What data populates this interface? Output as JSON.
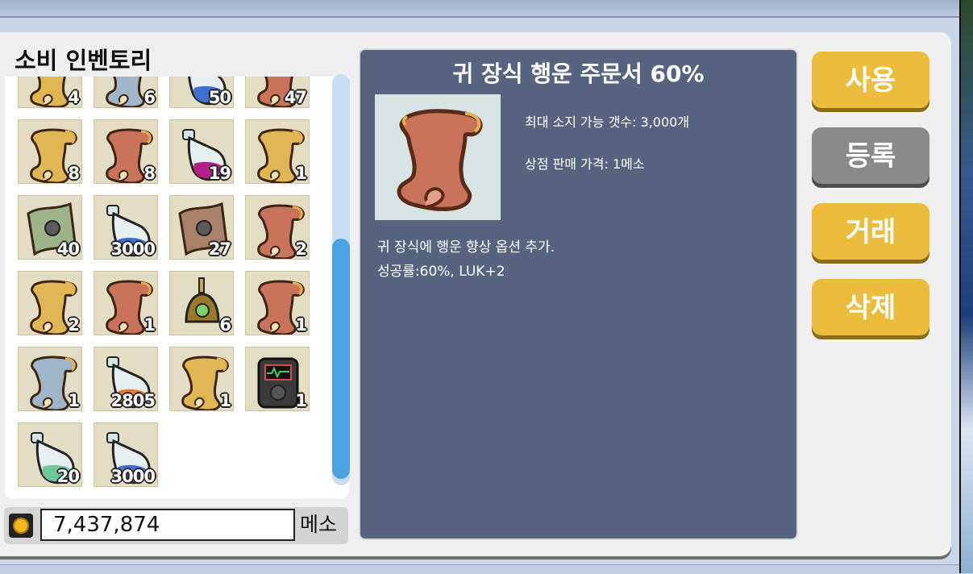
{
  "inventory": {
    "title": "소비 인벤토리",
    "slots": [
      {
        "type": "scroll-gold",
        "qty": "4"
      },
      {
        "type": "scroll-blue",
        "qty": "6"
      },
      {
        "type": "potion-blue",
        "qty": "50"
      },
      {
        "type": "scroll-red",
        "qty": "47"
      },
      {
        "type": "scroll-gold",
        "qty": "8"
      },
      {
        "type": "scroll-red",
        "qty": "8"
      },
      {
        "type": "potion-magenta",
        "qty": "19"
      },
      {
        "type": "scroll-gold",
        "qty": "1"
      },
      {
        "type": "scroll-green-map",
        "qty": "40"
      },
      {
        "type": "potion-blue",
        "qty": "3000"
      },
      {
        "type": "scroll-brown-map",
        "qty": "27"
      },
      {
        "type": "scroll-red",
        "qty": "2"
      },
      {
        "type": "scroll-gold",
        "qty": "2"
      },
      {
        "type": "scroll-red",
        "qty": "1"
      },
      {
        "type": "bell",
        "qty": "6"
      },
      {
        "type": "scroll-red",
        "qty": "1"
      },
      {
        "type": "scroll-blue",
        "qty": "1"
      },
      {
        "type": "potion-orange",
        "qty": "2805"
      },
      {
        "type": "scroll-gold",
        "qty": "1"
      },
      {
        "type": "device",
        "qty": "1"
      },
      {
        "type": "potion-green",
        "qty": "20"
      },
      {
        "type": "potion-blue",
        "qty": "3000"
      }
    ]
  },
  "meso": {
    "amount": "7,437,874",
    "unit": "메소"
  },
  "detail": {
    "title": "귀 장식 행운 주문서 60%",
    "max_stack": "최대 소지 가능 갯수: 3,000개",
    "shop_price": "상점 판매 가격: 1메소",
    "desc_line1": "귀 장식에 행운 향상 옵션 추가.",
    "desc_line2": "성공률:60%, LUK+2"
  },
  "buttons": {
    "use": "사용",
    "register": "등록",
    "trade": "거래",
    "delete": "삭제"
  },
  "colors": {
    "scroll-gold": "#e0b655",
    "scroll-red": "#c8735a",
    "scroll-blue": "#9fb6c9",
    "potion-blue": "#3f6fd1",
    "potion-magenta": "#b3218b",
    "potion-orange": "#e8782a",
    "potion-green": "#6fc79a",
    "accent_button": "#ecbd3d",
    "detail_bg": "#57647f"
  }
}
